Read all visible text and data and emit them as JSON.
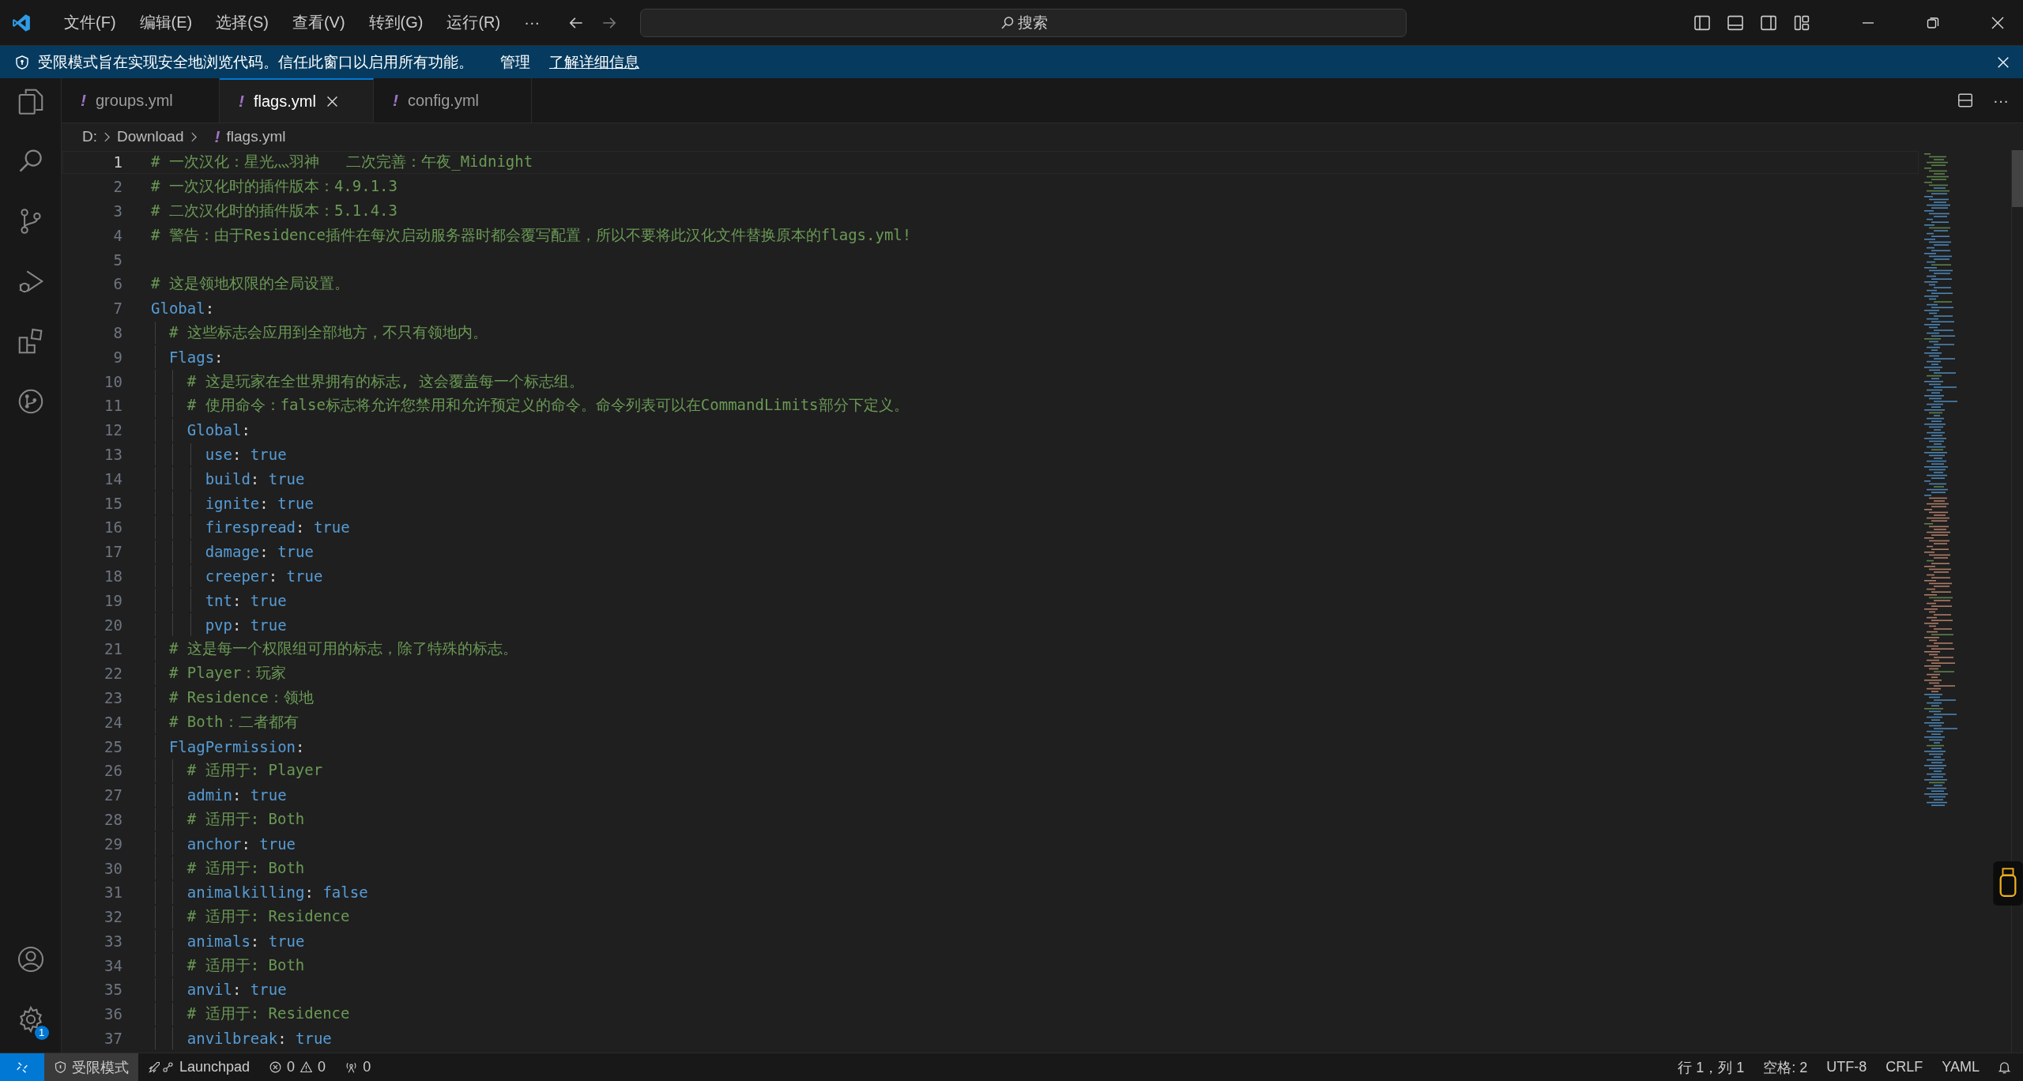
{
  "window": {
    "menu": [
      "文件(F)",
      "编辑(E)",
      "选择(S)",
      "查看(V)",
      "转到(G)",
      "运行(R)"
    ],
    "more": "···",
    "search": {
      "placeholder": "搜索"
    }
  },
  "banner": {
    "text": "受限模式旨在实现安全地浏览代码。信任此窗口以启用所有功能。",
    "links": [
      "管理",
      "了解详细信息"
    ]
  },
  "activity_bar": {
    "items": [
      {
        "kind": "explorer"
      },
      {
        "kind": "search"
      },
      {
        "kind": "source-control"
      },
      {
        "kind": "run-debug"
      },
      {
        "kind": "extensions"
      },
      {
        "kind": "remote"
      }
    ],
    "settings_badge": "1"
  },
  "tabs": [
    {
      "icon": "!",
      "label": "groups.yml",
      "selected": false
    },
    {
      "icon": "!",
      "label": "flags.yml",
      "selected": true
    },
    {
      "icon": "!",
      "label": "config.yml",
      "selected": false
    }
  ],
  "breadcrumb": [
    {
      "label": "D:"
    },
    {
      "label": "Download"
    },
    {
      "icon": "!",
      "label": "flags.yml"
    }
  ],
  "lines": [
    {
      "number": "1",
      "kind": "comment",
      "text": "# 一次汉化：星光灬羽神   二次完善：午夜_Midnight",
      "current": true
    },
    {
      "number": "2",
      "kind": "comment",
      "text": "# 一次汉化时的插件版本：4.9.1.3",
      "current": false
    },
    {
      "number": "3",
      "kind": "comment",
      "text": "# 二次汉化时的插件版本：5.1.4.3",
      "current": false
    },
    {
      "number": "4",
      "kind": "comment",
      "text": "# 警告：由于Residence插件在每次启动服务器时都会覆写配置，所以不要将此汉化文件替换原本的flags.yml!",
      "current": false
    },
    {
      "number": "5",
      "kind": "empty",
      "current": false
    },
    {
      "number": "6",
      "kind": "comment",
      "text": "# 这是领地权限的全局设置。",
      "current": false
    },
    {
      "number": "7",
      "kind": "key",
      "key": "Global:",
      "current": false
    },
    {
      "number": "8",
      "kind": "comment",
      "text": "  # 这些标志会应用到全部地方，不只有领地内。",
      "current": false
    },
    {
      "number": "9",
      "kind": "key",
      "key": "  Flags:",
      "current": false
    },
    {
      "number": "10",
      "kind": "comment",
      "text": "    # 这是玩家在全世界拥有的标志, 这会覆盖每一个标志组。",
      "current": false
    },
    {
      "number": "11",
      "kind": "comment",
      "text": "    # 使用命令：false标志将允许您禁用和允许预定义的命令。命令列表可以在CommandLimits部分下定义。",
      "current": false
    },
    {
      "number": "12",
      "kind": "key",
      "key": "    Global:",
      "current": false
    },
    {
      "number": "13",
      "kind": "pair",
      "key": "      use:",
      "value": "true",
      "current": false
    },
    {
      "number": "14",
      "kind": "pair",
      "key": "      build:",
      "value": "true",
      "current": false
    },
    {
      "number": "15",
      "kind": "pair",
      "key": "      ignite:",
      "value": "true",
      "current": false
    },
    {
      "number": "16",
      "kind": "pair",
      "key": "      firespread:",
      "value": "true",
      "current": false
    },
    {
      "number": "17",
      "kind": "pair",
      "key": "      damage:",
      "value": "true",
      "current": false
    },
    {
      "number": "18",
      "kind": "pair",
      "key": "      creeper:",
      "value": "true",
      "current": false
    },
    {
      "number": "19",
      "kind": "pair",
      "key": "      tnt:",
      "value": "true",
      "current": false
    },
    {
      "number": "20",
      "kind": "pair",
      "key": "      pvp:",
      "value": "true",
      "current": false
    },
    {
      "number": "21",
      "kind": "comment",
      "text": "  # 这是每一个权限组可用的标志，除了特殊的标志。",
      "current": false
    },
    {
      "number": "22",
      "kind": "comment",
      "text": "  # Player：玩家",
      "current": false
    },
    {
      "number": "23",
      "kind": "comment",
      "text": "  # Residence：领地",
      "current": false
    },
    {
      "number": "24",
      "kind": "comment",
      "text": "  # Both：二者都有",
      "current": false
    },
    {
      "number": "25",
      "kind": "key",
      "key": "  FlagPermission:",
      "current": false
    },
    {
      "number": "26",
      "kind": "comment",
      "text": "    # 适用于: Player",
      "current": false
    },
    {
      "number": "27",
      "kind": "pair",
      "key": "    admin:",
      "value": "true",
      "current": false
    },
    {
      "number": "28",
      "kind": "comment",
      "text": "    # 适用于: Both",
      "current": false
    },
    {
      "number": "29",
      "kind": "pair",
      "key": "    anchor:",
      "value": "true",
      "current": false
    },
    {
      "number": "30",
      "kind": "comment",
      "text": "    # 适用于: Both",
      "current": false
    },
    {
      "number": "31",
      "kind": "pair",
      "key": "    animalkilling:",
      "value": "false",
      "current": false
    },
    {
      "number": "32",
      "kind": "comment",
      "text": "    # 适用于: Residence",
      "current": false
    },
    {
      "number": "33",
      "kind": "pair",
      "key": "    animals:",
      "value": "true",
      "current": false
    },
    {
      "number": "34",
      "kind": "comment",
      "text": "    # 适用于: Both",
      "current": false
    },
    {
      "number": "35",
      "kind": "pair",
      "key": "    anvil:",
      "value": "true",
      "current": false
    },
    {
      "number": "36",
      "kind": "comment",
      "text": "    # 适用于: Residence",
      "current": false
    },
    {
      "number": "37",
      "kind": "pair",
      "key": "    anvilbreak:",
      "value": "true",
      "current": false
    }
  ],
  "status_bar": {
    "left": [
      {
        "kind": "restricted",
        "label": "受限模式"
      },
      {
        "kind": "launchpad",
        "label": "Launchpad"
      },
      {
        "kind": "problems",
        "errors": "0",
        "warnings": "0"
      },
      {
        "kind": "ports",
        "label": "0"
      }
    ],
    "right": [
      "行 1，列 1",
      "空格: 2",
      "UTF-8",
      "CRLF",
      "YAML"
    ]
  }
}
